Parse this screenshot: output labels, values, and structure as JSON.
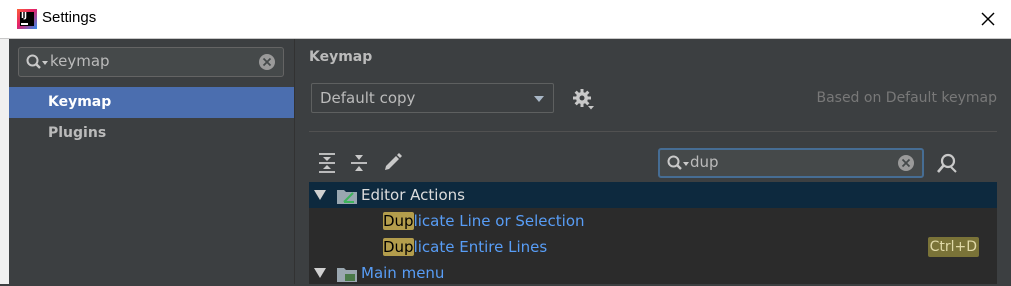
{
  "window": {
    "title": "Settings"
  },
  "sidebar": {
    "search": {
      "value": "keymap"
    },
    "items": [
      {
        "label": "Keymap",
        "selected": true
      },
      {
        "label": "Plugins",
        "selected": false
      }
    ]
  },
  "main": {
    "title": "Keymap",
    "keymap_select": {
      "value": "Default copy"
    },
    "based_on": "Based on Default keymap",
    "filter": {
      "value": "dup"
    },
    "tree": [
      {
        "label": "Editor Actions",
        "type": "group",
        "expanded": true,
        "selected": true
      },
      {
        "label_match": "Dup",
        "label_rest": "licate Line or Selection",
        "type": "action",
        "shortcut": ""
      },
      {
        "label_match": "Dup",
        "label_rest": "licate Entire Lines",
        "type": "action",
        "shortcut": "Ctrl+D"
      },
      {
        "label": "Main menu",
        "type": "group",
        "expanded": true,
        "selected": false
      }
    ]
  },
  "colors": {
    "background": "#3c3f41",
    "selection": "#4b6eaf",
    "tree_background": "#2b2b2b",
    "tree_selected_row": "#0d293e",
    "link_text": "#589df6",
    "match_highlight": "#b39d4c"
  },
  "icons": [
    "app-logo-icon",
    "close-icon",
    "search-icon",
    "clear-icon",
    "gear-icon",
    "expand-all-icon",
    "collapse-all-icon",
    "edit-icon",
    "find-shortcut-icon",
    "folder-icon"
  ]
}
